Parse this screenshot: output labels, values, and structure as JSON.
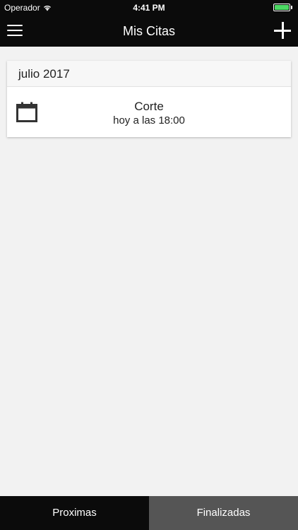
{
  "status_bar": {
    "carrier": "Operador",
    "time": "4:41 PM",
    "wifi_icon": "wifi-icon",
    "battery_icon": "battery-icon",
    "battery_color": "#4cd964"
  },
  "nav": {
    "title": "Mis Citas",
    "menu_icon": "hamburger-menu-icon",
    "add_icon": "plus-icon"
  },
  "appointments": {
    "month_header": "julio 2017",
    "items": [
      {
        "title": "Corte",
        "time": "hoy a las 18:00",
        "icon": "calendar-icon"
      }
    ]
  },
  "tabs": [
    {
      "label": "Proximas",
      "active": true
    },
    {
      "label": "Finalizadas",
      "active": false
    }
  ],
  "colors": {
    "bar_dark": "#0b0b0b",
    "tab_inactive": "#555555",
    "background": "#f2f2f2"
  }
}
